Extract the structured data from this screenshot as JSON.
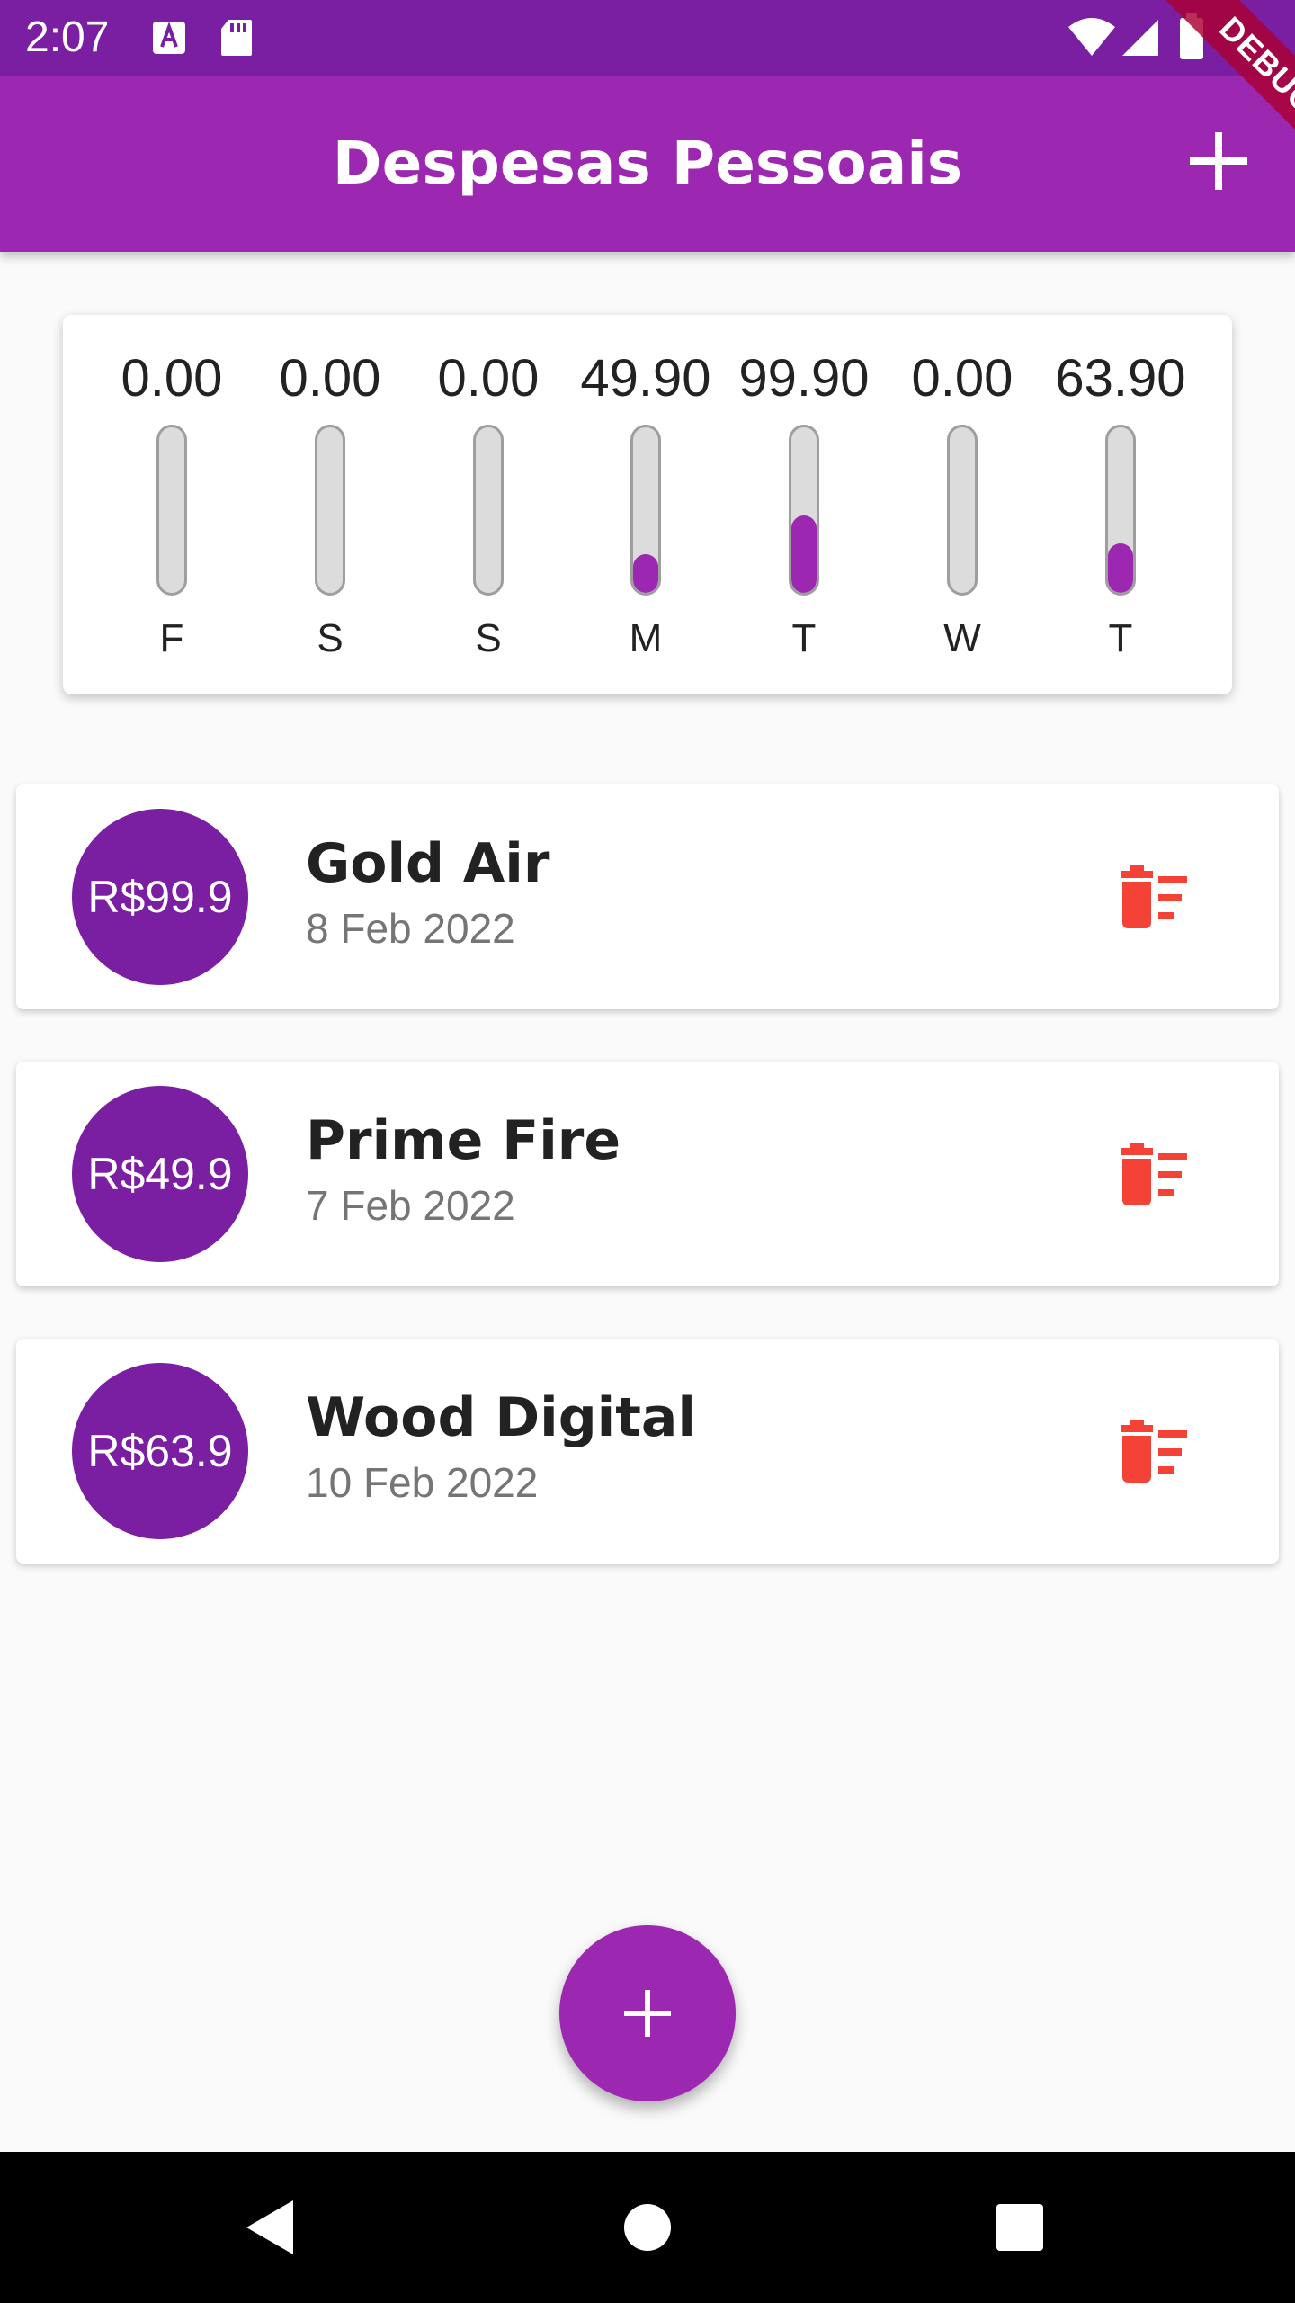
{
  "status_bar": {
    "time": "2:07",
    "icons": [
      "keyboard-icon",
      "sd-card-icon",
      "wifi-icon",
      "signal-icon",
      "battery-icon"
    ]
  },
  "app_bar": {
    "title": "Despesas Pessoais",
    "add_icon": "plus-icon"
  },
  "debug_banner": "DEBUG",
  "chart": {
    "columns": [
      {
        "day": "F",
        "amount": "0.00",
        "fraction": 0
      },
      {
        "day": "S",
        "amount": "0.00",
        "fraction": 0
      },
      {
        "day": "S",
        "amount": "0.00",
        "fraction": 0
      },
      {
        "day": "M",
        "amount": "49.90",
        "fraction": 0.234
      },
      {
        "day": "T",
        "amount": "99.90",
        "fraction": 0.468
      },
      {
        "day": "W",
        "amount": "0.00",
        "fraction": 0
      },
      {
        "day": "T",
        "amount": "63.90",
        "fraction": 0.299
      }
    ]
  },
  "transactions": [
    {
      "value": "R$99.9",
      "title": "Gold Air",
      "date": "8 Feb 2022",
      "delete_icon": "delete-sweep-icon"
    },
    {
      "value": "R$49.9",
      "title": "Prime Fire",
      "date": "7 Feb 2022",
      "delete_icon": "delete-sweep-icon"
    },
    {
      "value": "R$63.9",
      "title": "Wood Digital",
      "date": "10 Feb 2022",
      "delete_icon": "delete-sweep-icon"
    }
  ],
  "fab_icon": "plus-icon",
  "nav_bar": [
    "back-icon",
    "home-icon",
    "recents-icon"
  ],
  "colors": {
    "primary": "#9c27b0",
    "primary_dark": "#7b1fa2",
    "delete": "#f44336",
    "background": "#fafafa"
  }
}
